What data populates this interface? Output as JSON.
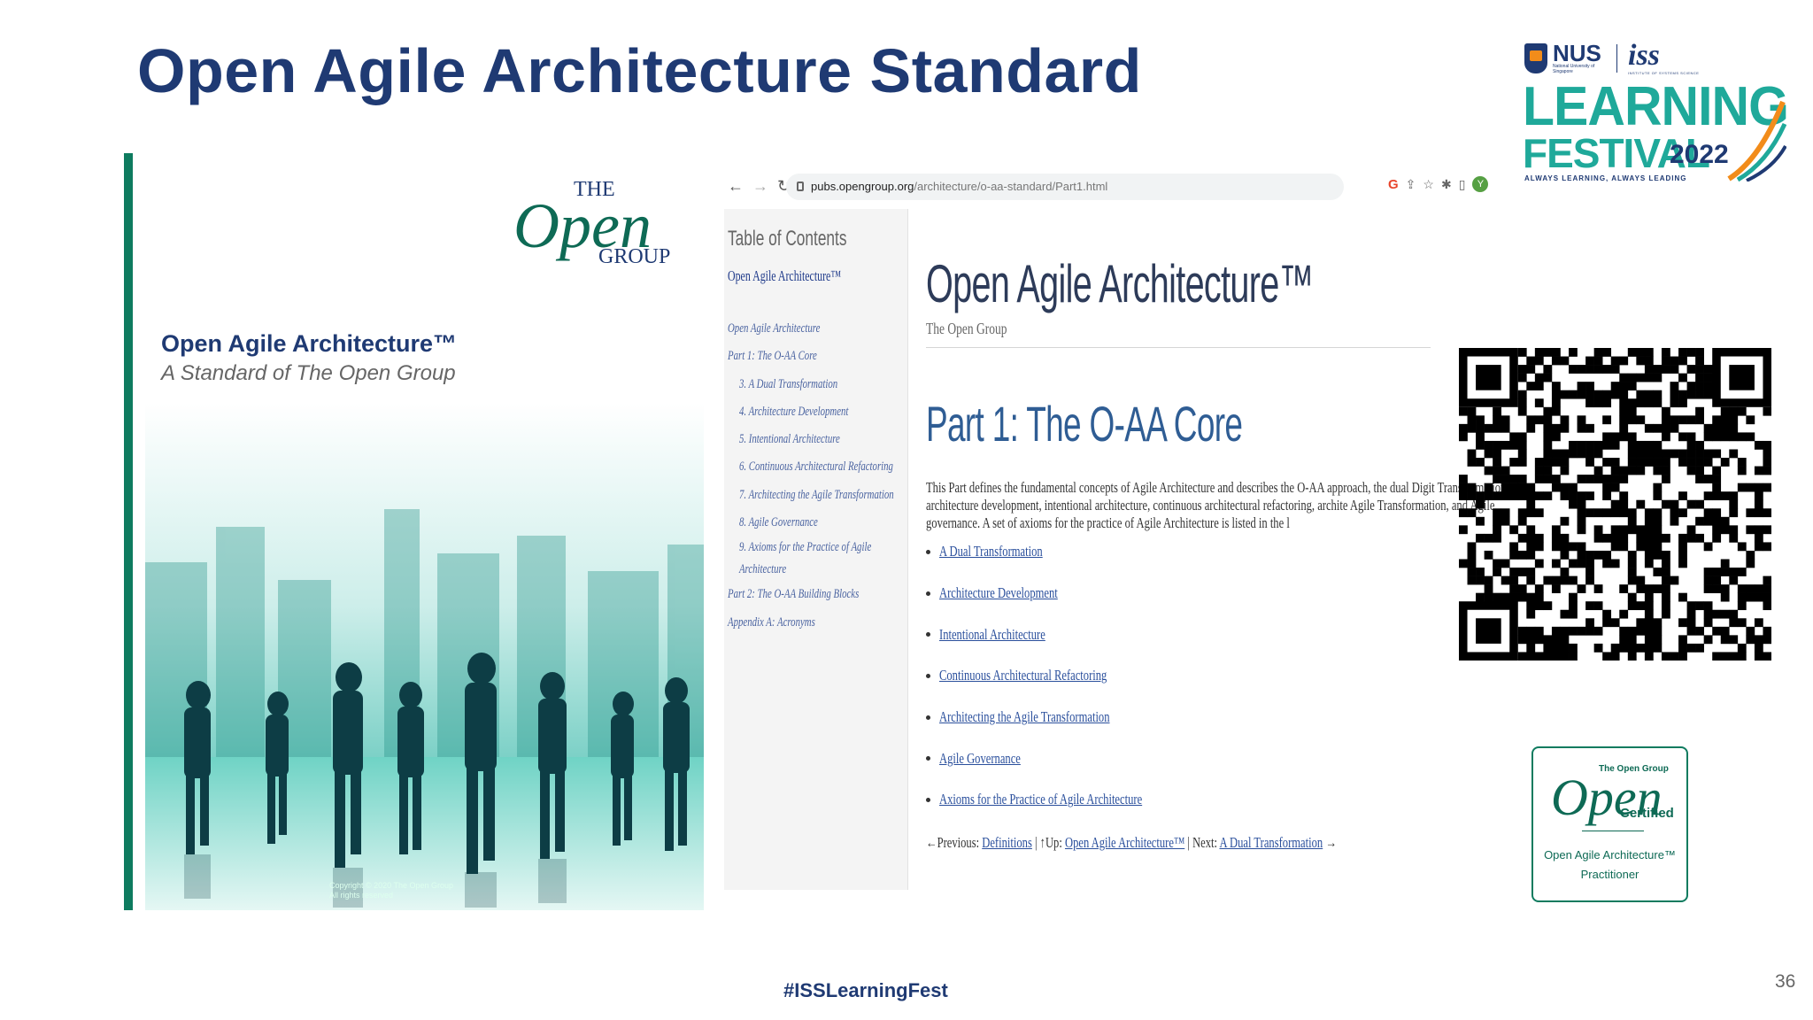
{
  "slide": {
    "title": "Open Agile Architecture Standard",
    "hashtag": "#ISSLearningFest",
    "page_number": "36"
  },
  "festival_logo": {
    "nus": "NUS",
    "nus_sub": "National University of Singapore",
    "iss": "iss",
    "iss_sub": "INSTITUTE OF SYSTEMS SCIENCE",
    "learning": "LEARNING",
    "festival": "FESTIVAL",
    "year": "2022",
    "tagline": "ALWAYS LEARNING, ALWAYS LEADING",
    "colors": {
      "teal": "#1fa99a",
      "navy": "#1f3a73",
      "orange": "#f28c1a"
    }
  },
  "cover": {
    "logo_the": "THE",
    "logo_open": "Open",
    "logo_group": "GROUP",
    "title": "Open Agile Architecture™",
    "subtitle": "A Standard of The Open Group",
    "copyright_line1": "Copyright © 2020 The Open Group",
    "copyright_line2": "All rights reserved"
  },
  "browser": {
    "url_host": "pubs.opengroup.org",
    "url_path": "/architecture/o-aa-standard/Part1.html",
    "profile_initial": "Y",
    "toc": {
      "heading": "Table of Contents",
      "book_title": "Open Agile Architecture™",
      "items": [
        {
          "label": "Open Agile Architecture",
          "indent": false
        },
        {
          "label": "Part 1: The O-AA Core",
          "indent": false
        },
        {
          "label": "3. A Dual Transformation",
          "indent": true
        },
        {
          "label": "4. Architecture Development",
          "indent": true
        },
        {
          "label": "5. Intentional Architecture",
          "indent": true
        },
        {
          "label": "6. Continuous Architectural Refactoring",
          "indent": true
        },
        {
          "label": "7. Architecting the Agile Transformation",
          "indent": true
        },
        {
          "label": "8. Agile Governance",
          "indent": true
        },
        {
          "label": "9. Axioms for the Practice of Agile Architecture",
          "indent": true
        },
        {
          "label": "Part 2: The O-AA Building Blocks",
          "indent": false
        },
        {
          "label": "Appendix A: Acronyms",
          "indent": false
        }
      ]
    },
    "doc_title": "Open Agile Architecture™",
    "doc_publisher": "The Open Group",
    "part_heading": "Part 1: The O-AA Core",
    "part_description": "This Part defines the fundamental concepts of Agile Architecture and describes the O-AA approach, the dual Digit Transformation, architecture development, intentional architecture, continuous architectural refactoring, archite Agile Transformation, and Agile governance. A set of axioms for the practice of Agile Architecture is listed in the l",
    "chapters": [
      "A Dual Transformation",
      "Architecture Development",
      "Intentional Architecture",
      "Continuous Architectural Refactoring",
      "Architecting the Agile Transformation",
      "Agile Governance",
      "Axioms for the Practice of Agile Architecture"
    ],
    "pager": {
      "prev_label": "←Previous:",
      "prev_link": "Definitions",
      "up_label": "| ↑Up:",
      "up_link": "Open Agile Architecture™",
      "next_label": "| Next:",
      "next_link": "A Dual Transformation",
      "next_arrow": "→"
    }
  },
  "badge": {
    "group": "The Open Group",
    "open": "Open",
    "certified": "Certified",
    "line1": "Open Agile Architecture™",
    "line2": "Practitioner"
  }
}
